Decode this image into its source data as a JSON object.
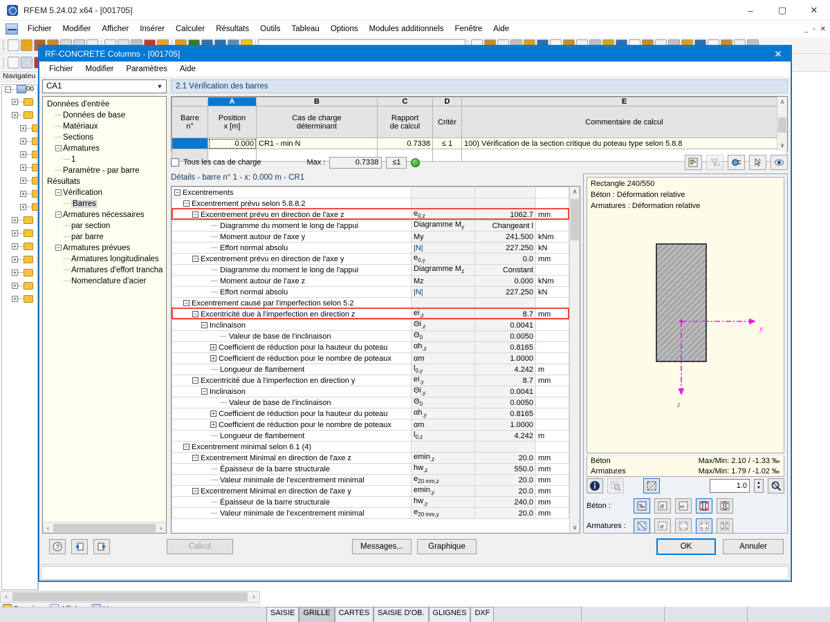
{
  "app": {
    "title": "RFEM 5.24.02 x64 - [001705]",
    "window_buttons": [
      "–",
      "▢",
      "✕"
    ],
    "inner_window_buttons": [
      "_",
      "▫",
      "✕"
    ],
    "menu": [
      "Fichier",
      "Modifier",
      "Afficher",
      "Insérer",
      "Calculer",
      "Résultats",
      "Outils",
      "Tableau",
      "Options",
      "Modules additionnels",
      "Fenêtre",
      "Aide"
    ]
  },
  "navigator": {
    "title": "Navigateu",
    "root_label": "00"
  },
  "workspace": {
    "bottom_tabs": [
      {
        "label": "Données",
        "icon": "data-icon"
      },
      {
        "label": "Afficher",
        "icon": "display-icon"
      },
      {
        "label": "Vues",
        "icon": "views-icon"
      }
    ]
  },
  "statusbar": {
    "tabs": [
      {
        "label": "SAISIE",
        "active": false
      },
      {
        "label": "GRILLE",
        "active": true
      },
      {
        "label": "CARTES",
        "active": false
      },
      {
        "label": "SAISIE D'OB.",
        "active": false
      },
      {
        "label": "GLIGNES",
        "active": false
      },
      {
        "label": "DXF",
        "active": false
      }
    ]
  },
  "dialog": {
    "title": "RF-CONCRETE Columns - [001705]",
    "close_label": "✕",
    "menu": [
      "Fichier",
      "Modifier",
      "Paramètres",
      "Aide"
    ],
    "combo_value": "CA1",
    "tree": [
      {
        "label": "Données d'entrée",
        "indent": 0,
        "expander": "",
        "leaf": false
      },
      {
        "label": "Données de base",
        "indent": 1,
        "expander": "",
        "leaf": true
      },
      {
        "label": "Matériaux",
        "indent": 1,
        "expander": "",
        "leaf": true
      },
      {
        "label": "Sections",
        "indent": 1,
        "expander": "",
        "leaf": true
      },
      {
        "label": "Armatures",
        "indent": 1,
        "expander": "−",
        "leaf": false
      },
      {
        "label": "1",
        "indent": 2,
        "expander": "",
        "leaf": true
      },
      {
        "label": "Paramètre - par barre",
        "indent": 1,
        "expander": "",
        "leaf": true
      },
      {
        "label": "Résultats",
        "indent": 0,
        "expander": "",
        "leaf": false
      },
      {
        "label": "Vérification",
        "indent": 1,
        "expander": "−",
        "leaf": false
      },
      {
        "label": "Barres",
        "indent": 2,
        "expander": "",
        "leaf": true,
        "selected": true
      },
      {
        "label": "Armatures nécessaires",
        "indent": 1,
        "expander": "−",
        "leaf": false
      },
      {
        "label": "par section",
        "indent": 2,
        "expander": "",
        "leaf": true
      },
      {
        "label": "par barre",
        "indent": 2,
        "expander": "",
        "leaf": true
      },
      {
        "label": "Armatures prévues",
        "indent": 1,
        "expander": "−",
        "leaf": false
      },
      {
        "label": "Armatures longitudinales",
        "indent": 2,
        "expander": "",
        "leaf": true
      },
      {
        "label": "Armatures d'effort trancha",
        "indent": 2,
        "expander": "",
        "leaf": true
      },
      {
        "label": "Nomenclature d'acier",
        "indent": 2,
        "expander": "",
        "leaf": true
      }
    ],
    "section_title": "2.1 Vérification des barres",
    "grid": {
      "column_letters": [
        "",
        "A",
        "B",
        "C",
        "D",
        "E"
      ],
      "active_letter": "A",
      "headers": [
        {
          "line1": "Barre",
          "line2": "n°"
        },
        {
          "line1": "Position",
          "line2": "x [m]"
        },
        {
          "line1": "Cas de charge",
          "line2": "déterminant"
        },
        {
          "line1": "Rapport",
          "line2": "de calcul"
        },
        {
          "line1": "",
          "line2": "Critèr"
        },
        {
          "line1": "",
          "line2": "Commentaire de calcul"
        }
      ],
      "rows": [
        {
          "bar": "",
          "position": "0.000",
          "load_case": "CR1 - min N",
          "ratio": "0.7338",
          "criterion": "≤ 1",
          "comment": "100) Vérification de la section critique du poteau type selon 5.8.8"
        }
      ]
    },
    "max_row": {
      "checkbox_label": "Tous les cas de charge",
      "max_label": "Max :",
      "max_value": "0.7338",
      "criterion": "≤1",
      "status_icon": "green-smiley-icon"
    },
    "grid_tools": [
      "report-icon",
      "filter-icon",
      "color-view-icon",
      "pick-icon",
      "eye-icon"
    ],
    "details_header": "Détails  -  barre n° 1  -  x: 0.000 m  -  CR1",
    "details_rows": [
      {
        "indent": 0,
        "expander": "−",
        "label": "Excentrements",
        "symbol": "",
        "value": "",
        "unit": "",
        "highlight": false,
        "header": true
      },
      {
        "indent": 1,
        "expander": "−",
        "label": "Excentrement prévu selon 5.8.8.2",
        "symbol": "",
        "value": "",
        "unit": "",
        "highlight": false
      },
      {
        "indent": 2,
        "expander": "−",
        "label": "Excentrement prévu en direction de l'axe z",
        "symbol": "e0,z",
        "value": "1062.7",
        "unit": "mm",
        "highlight": true
      },
      {
        "indent": 3,
        "expander": "",
        "label": "Diagramme du moment le long de l'appui",
        "symbol": "Diagramme My",
        "value": "Changeant l",
        "unit": "",
        "highlight": false
      },
      {
        "indent": 3,
        "expander": "",
        "label": "Moment autour de l'axe y",
        "symbol": "My",
        "value": "241.500",
        "unit": "kNm",
        "highlight": false
      },
      {
        "indent": 3,
        "expander": "",
        "label": "Effort normal absolu",
        "symbol": "|N|",
        "value": "227.250",
        "unit": "kN",
        "highlight": false
      },
      {
        "indent": 2,
        "expander": "−",
        "label": "Excentrement prévu en direction de l'axe y",
        "symbol": "e0,y",
        "value": "0.0",
        "unit": "mm",
        "highlight": false
      },
      {
        "indent": 3,
        "expander": "",
        "label": "Diagramme du moment le long de l'appui",
        "symbol": "Diagramme Mz",
        "value": "Constant",
        "unit": "",
        "highlight": false
      },
      {
        "indent": 3,
        "expander": "",
        "label": "Moment autour de l'axe z",
        "symbol": "Mz",
        "value": "0.000",
        "unit": "kNm",
        "highlight": false
      },
      {
        "indent": 3,
        "expander": "",
        "label": "Effort normal absolu",
        "symbol": "|N|",
        "value": "227.250",
        "unit": "kN",
        "highlight": false
      },
      {
        "indent": 1,
        "expander": "−",
        "label": "Excentrement causé par l'imperfection selon 5.2",
        "symbol": "",
        "value": "",
        "unit": "",
        "highlight": false
      },
      {
        "indent": 2,
        "expander": "−",
        "label": "Excentricité due à l'imperfection en direction z",
        "symbol": "ei,z",
        "value": "8.7",
        "unit": "mm",
        "highlight": true
      },
      {
        "indent": 3,
        "expander": "−",
        "label": "Inclinaison",
        "symbol": "Θi,z",
        "value": "0.0041",
        "unit": "",
        "highlight": false
      },
      {
        "indent": 4,
        "expander": "",
        "label": "Valeur de base de l'inclinaison",
        "symbol": "Θ0",
        "value": "0.0050",
        "unit": "",
        "highlight": false
      },
      {
        "indent": 4,
        "expander": "+",
        "label": "Coefficient de réduction pour la hauteur du poteau",
        "symbol": "αh,z",
        "value": "0.8165",
        "unit": "",
        "highlight": false
      },
      {
        "indent": 4,
        "expander": "+",
        "label": "Coefficient de réduction pour le nombre de poteaux",
        "symbol": "αm",
        "value": "1.0000",
        "unit": "",
        "highlight": false
      },
      {
        "indent": 3,
        "expander": "",
        "label": "Longueur de flambement",
        "symbol": "l0,y",
        "value": "4.242",
        "unit": "m",
        "highlight": false
      },
      {
        "indent": 2,
        "expander": "−",
        "label": "Excentricité due à l'imperfection en direction y",
        "symbol": "ei,y",
        "value": "8.7",
        "unit": "mm",
        "highlight": false
      },
      {
        "indent": 3,
        "expander": "−",
        "label": "Inclinaison",
        "symbol": "Θi,y",
        "value": "0.0041",
        "unit": "",
        "highlight": false
      },
      {
        "indent": 4,
        "expander": "",
        "label": "Valeur de base de l'inclinaison",
        "symbol": "Θ0",
        "value": "0.0050",
        "unit": "",
        "highlight": false
      },
      {
        "indent": 4,
        "expander": "+",
        "label": "Coefficient de réduction pour la hauteur du poteau",
        "symbol": "αh,y",
        "value": "0.8165",
        "unit": "",
        "highlight": false
      },
      {
        "indent": 4,
        "expander": "+",
        "label": "Coefficient de réduction pour le nombre de poteaux",
        "symbol": "αm",
        "value": "1.0000",
        "unit": "",
        "highlight": false
      },
      {
        "indent": 3,
        "expander": "",
        "label": "Longueur de flambement",
        "symbol": "l0,z",
        "value": "4.242",
        "unit": "m",
        "highlight": false
      },
      {
        "indent": 1,
        "expander": "−",
        "label": "Excentrement minimal selon 6.1 (4)",
        "symbol": "",
        "value": "",
        "unit": "",
        "highlight": false
      },
      {
        "indent": 2,
        "expander": "−",
        "label": "Excentrement Minimal en direction de l'axe z",
        "symbol": "emin,z",
        "value": "20.0",
        "unit": "mm",
        "highlight": false
      },
      {
        "indent": 3,
        "expander": "",
        "label": "Épaisseur de la barre structurale",
        "symbol": "hw,z",
        "value": "550.0",
        "unit": "mm",
        "highlight": false
      },
      {
        "indent": 3,
        "expander": "",
        "label": "Valeur minimale de l'excentrement minimal",
        "symbol": "e20 mm,z",
        "value": "20.0",
        "unit": "mm",
        "highlight": false
      },
      {
        "indent": 2,
        "expander": "−",
        "label": "Excentrement Minimal en direction de l'axe y",
        "symbol": "emin,y",
        "value": "20.0",
        "unit": "mm",
        "highlight": false
      },
      {
        "indent": 3,
        "expander": "",
        "label": "Épaisseur de la barre structurale",
        "symbol": "hw,y",
        "value": "240.0",
        "unit": "mm",
        "highlight": false
      },
      {
        "indent": 3,
        "expander": "",
        "label": "Valeur minimale de l'excentrement minimal",
        "symbol": "e20 mm,y",
        "value": "20.0",
        "unit": "mm",
        "highlight": false
      }
    ],
    "graphic": {
      "caption_lines": [
        "Rectangle 240/550",
        "Béton : Déformation relative",
        "Armatures : Déformation relative"
      ],
      "axis_y_label": "y",
      "axis_z_label": "z",
      "minmax": [
        {
          "label": "Béton",
          "value": "Max/Min: 2.10 / -1.33 ‰"
        },
        {
          "label": "Armatures",
          "value": "Max/Min: 1.79 / -1.02 ‰"
        }
      ],
      "zoom_value": "1.0",
      "row_labels": {
        "concrete": "Béton :",
        "reinforcement": "Armatures :"
      },
      "toolbar_top": [
        "info-icon",
        "inspect-icon",
        "hatch-icon",
        "zoom-reset-icon"
      ],
      "concrete_buttons": [
        "strain-icon",
        "stress-icon",
        "force-icon",
        "diagram-icon",
        "points-icon"
      ],
      "reinforcement_buttons": [
        "rebar-strain-icon",
        "rebar-stress-icon",
        "rebar-force-icon",
        "rebar-diagram-icon",
        "rebar-points-icon"
      ]
    },
    "footer": {
      "left_buttons": [
        "help-icon",
        "prev-icon",
        "next-icon"
      ],
      "calc_label": "Calcul",
      "messages_label": "Messages...",
      "graphic_label": "Graphique",
      "ok_label": "OK",
      "cancel_label": "Annuler"
    }
  },
  "colors": {
    "accent": "#0078d4",
    "highlight_red": "#f4483c",
    "grid_selected": "#0a78d2",
    "panel_cream": "#fefce8",
    "magenta_axis": "#e81ee8"
  }
}
